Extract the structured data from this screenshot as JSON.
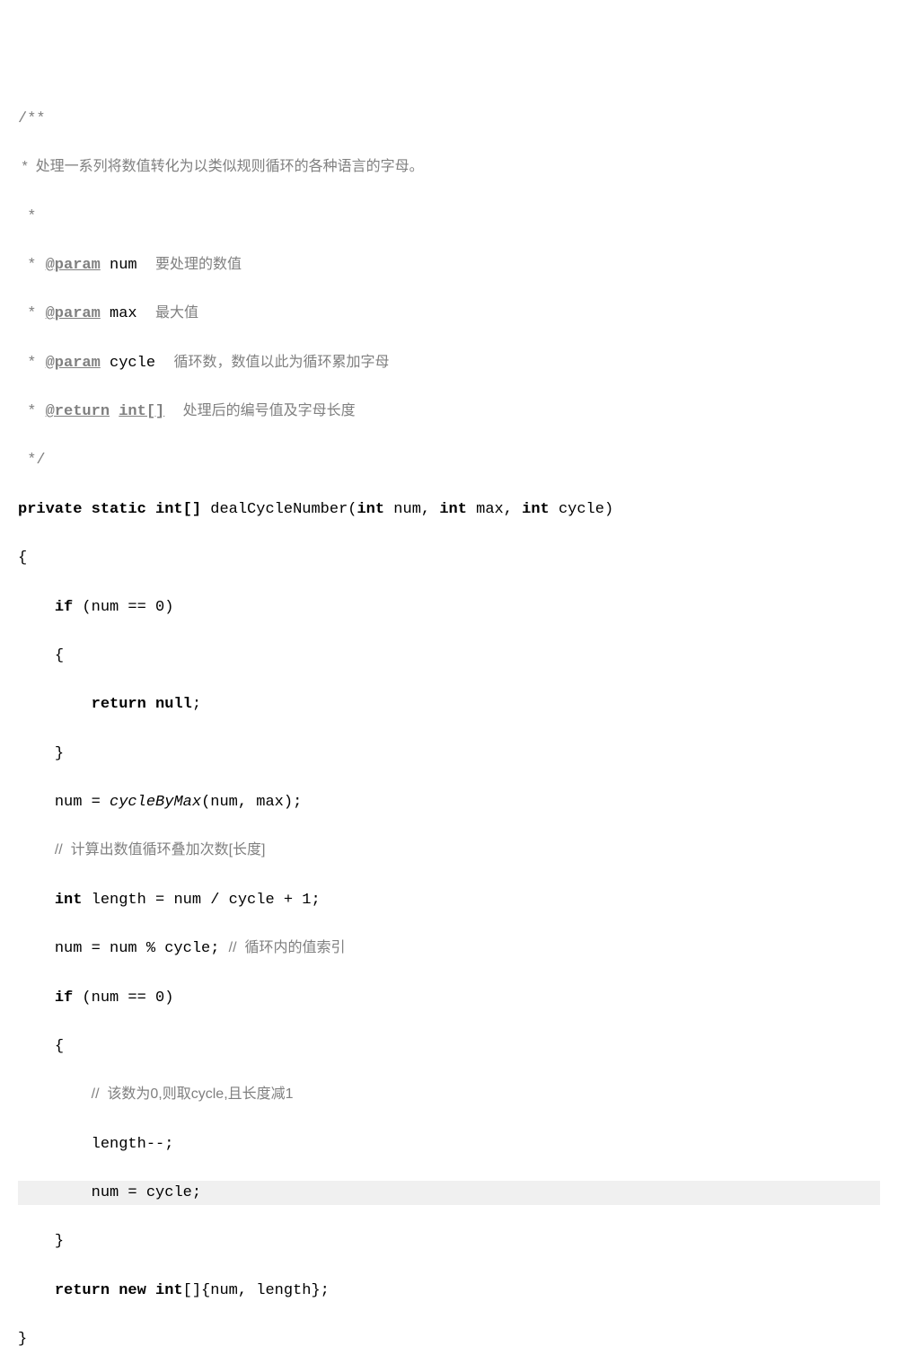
{
  "doc": {
    "open": "/**",
    "summary": " *  处理一系列将数值转化为以类似规则循环的各种语言的字母。",
    "blank": " *",
    "param1_tag": "@param",
    "param1_name": "num",
    "param1_desc": "要处理的数值",
    "param2_tag": "@param",
    "param2_name": "max",
    "param2_desc": "最大值",
    "param3_tag": "@param",
    "param3_name": "cycle",
    "param3_desc": "循环数，数值以此为循环累加字母",
    "return_tag": "@return",
    "return_type": "int[]",
    "return_desc": "处理后的编号值及字母长度",
    "close": " */"
  },
  "sig": {
    "mods": "private static int[]",
    "name": "dealCycleNumber",
    "p1t": "int",
    "p1n": "num",
    "p2t": "int",
    "p2n": "max",
    "p3t": "int",
    "p3n": "cycle"
  },
  "body": {
    "l1a": "if",
    "l1b": "(num == 0)",
    "l2": "{",
    "l3a": "return null",
    "l3b": ";",
    "l4": "}",
    "l5a": "num = ",
    "l5b": "cycleByMax",
    "l5c": "(num, max);",
    "l6": "//  计算出数值循环叠加次数[长度]",
    "l7a": "int",
    "l7b": " length = num / cycle + 1;",
    "l8a": "num = num % cycle; ",
    "l8b": "//  循环内的值索引",
    "l9a": "if",
    "l9b": "(num == 0)",
    "l10": "{",
    "l11": "//  该数为0,则取cycle,且长度减1",
    "l12": "length--;",
    "l13": "num = cycle;",
    "l14": "}",
    "l15a": "return new int",
    "l15b": "[]{num, length};",
    "l16": "}"
  }
}
